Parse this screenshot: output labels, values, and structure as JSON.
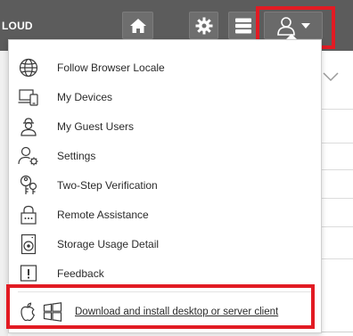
{
  "topbar": {
    "brand": "LOUD",
    "buttons": [
      "home-icon",
      "gear-icon",
      "list-icon",
      "user-icon"
    ]
  },
  "menu": {
    "items": [
      {
        "label": "Follow Browser Locale",
        "icon": "globe-icon"
      },
      {
        "label": "My Devices",
        "icon": "devices-icon"
      },
      {
        "label": "My Guest Users",
        "icon": "guest-user-icon"
      },
      {
        "label": "Settings",
        "icon": "user-settings-icon"
      },
      {
        "label": "Two-Step Verification",
        "icon": "key-icon"
      },
      {
        "label": "Remote Assistance",
        "icon": "lock-icon"
      },
      {
        "label": "Storage Usage Detail",
        "icon": "storage-icon"
      },
      {
        "label": "Feedback",
        "icon": "feedback-icon"
      }
    ],
    "download": {
      "label": "Download and install desktop or server client",
      "icons": [
        "apple-icon",
        "windows-icon"
      ]
    }
  },
  "colors": {
    "topbar": "#5c5c5c",
    "highlight": "#e21b23",
    "menu_bg": "#ffffff",
    "text": "#2b2b2b"
  }
}
